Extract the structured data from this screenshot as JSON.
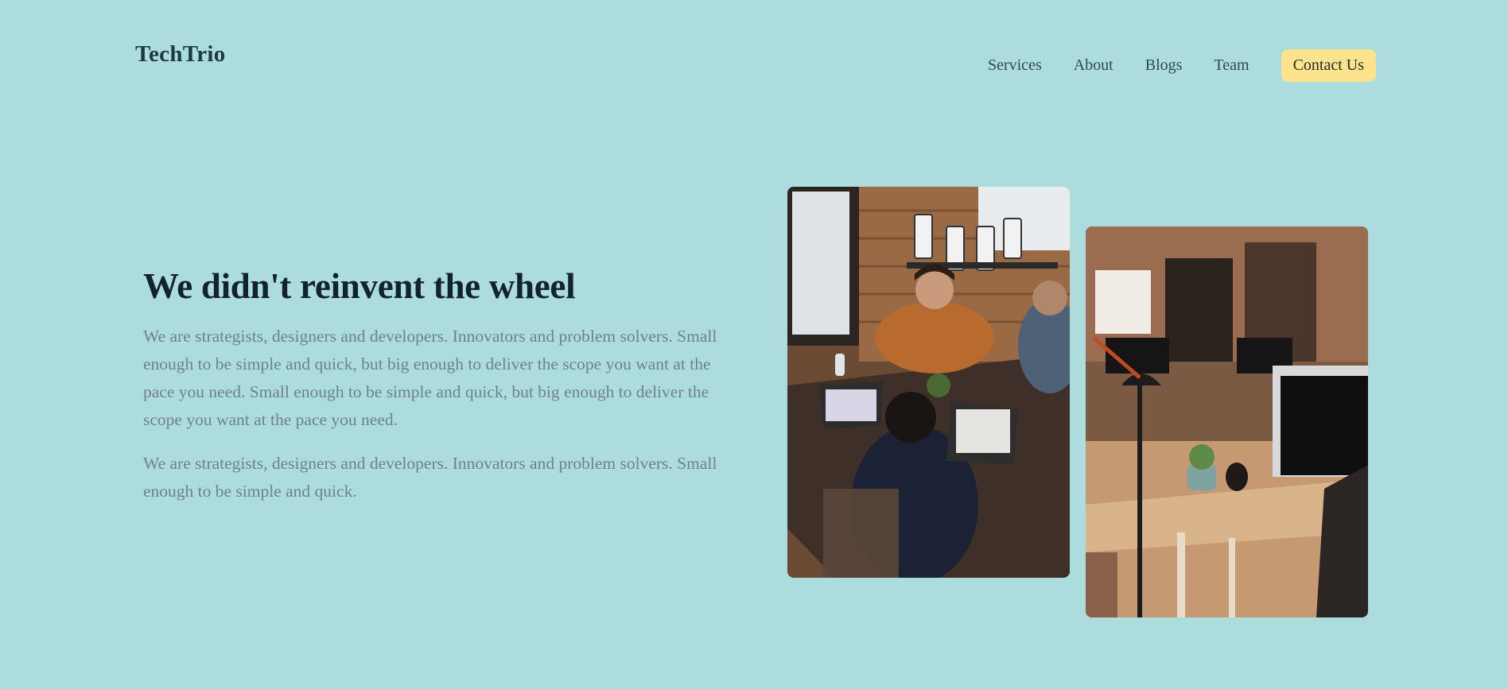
{
  "brand": {
    "name": "TechTrio"
  },
  "nav": {
    "items": [
      "Services",
      "About",
      "Blogs",
      "Team"
    ],
    "cta": "Contact Us"
  },
  "hero": {
    "title": "We didn't reinvent the wheel",
    "paragraph1": "We are strategists, designers and developers. Innovators and problem solvers. Small enough to be simple and quick, but big enough to deliver the scope you want at the pace you need. Small enough to be simple and quick, but big enough to deliver the scope you want at the pace you need.",
    "paragraph2": "We are strategists, designers and developers. Innovators and problem solvers. Small enough to be simple and quick."
  },
  "colors": {
    "background": "#addcdf",
    "cta_background": "#fde38b",
    "heading": "#13222f",
    "body_text": "#6c8389"
  },
  "images": [
    {
      "name": "team-meeting-photo",
      "depicts": "people working on laptops around a wooden table"
    },
    {
      "name": "office-workspace-photo",
      "depicts": "office desks with lamp, monitors and plant"
    }
  ]
}
